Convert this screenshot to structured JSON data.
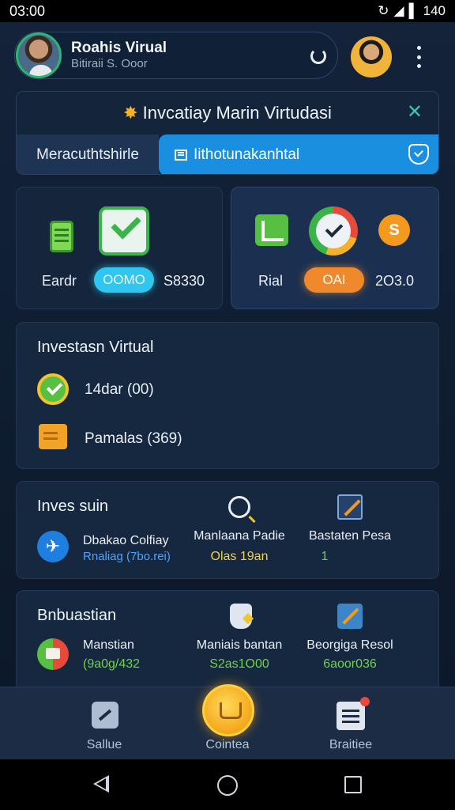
{
  "status_bar": {
    "time": "03:00",
    "battery": "140"
  },
  "header": {
    "name": "Roahis Virual",
    "subtitle": "Bitiraii S. Ooor"
  },
  "invest_panel": {
    "title": "Invcatiay Marin Virtudasi",
    "tab_left": "Meracuthtshirle",
    "tab_right": "Iithotunakanhtal"
  },
  "stats": {
    "card_a": {
      "label": "Eardr",
      "pill": "OOMO",
      "value": "S8330"
    },
    "card_b": {
      "label": "Rial",
      "pill": "OAI",
      "value": "2O3.0",
      "coin": "S"
    }
  },
  "section1": {
    "title": "Investasn Virtual",
    "rows": [
      {
        "text": "14dar (00)"
      },
      {
        "text": "Pamalas (369)"
      }
    ]
  },
  "section2": {
    "title": "Inves suin",
    "left_title": "Dbakao Colfiay",
    "left_sub": "Rnaliag (7bo.rei)",
    "mid_title": "Manlaana Padie",
    "mid_sub": "Olas 19an",
    "right_title": "Bastaten Pesa",
    "right_sub": "1"
  },
  "section3": {
    "title": "Bnbuastian",
    "left_title": "Manstian",
    "left_sub": "(9a0g/432",
    "mid_title": "Maniais bantan",
    "mid_sub": "S2as1O00",
    "right_title": "Beorgiga Resol",
    "right_sub": "6aoor036"
  },
  "bottom_nav": {
    "items": [
      {
        "label": "Sallue"
      },
      {
        "label": "Cointea"
      },
      {
        "label": "Braitiee"
      }
    ]
  },
  "colors": {
    "accent_blue": "#1a8fe0",
    "accent_orange": "#f0892b",
    "accent_cyan": "#2fc6ef",
    "accent_green": "#57c042"
  }
}
